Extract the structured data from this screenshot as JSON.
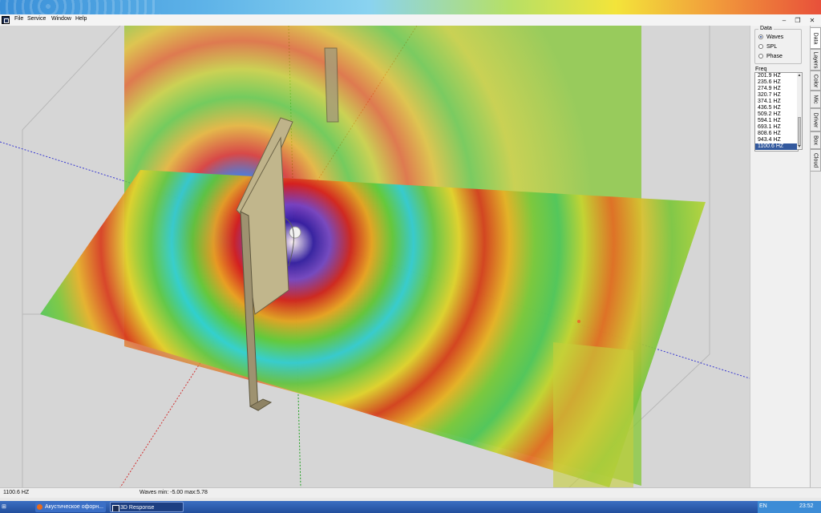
{
  "menu": [
    "File",
    "Service",
    "Window",
    "Help"
  ],
  "panel": {
    "data_group_label": "Data",
    "radios": [
      {
        "label": "Waves",
        "selected": true
      },
      {
        "label": "SPL",
        "selected": false
      },
      {
        "label": "Phase",
        "selected": false
      }
    ],
    "freq_label": "Freq",
    "frequencies": [
      "201.9 HZ",
      "235.6 HZ",
      "274.9 HZ",
      "320.7 HZ",
      "374.1 HZ",
      "436.5 HZ",
      "509.2 HZ",
      "594.1 HZ",
      "693.1 HZ",
      "808.6 HZ",
      "943.4 HZ",
      "1100.6 HZ"
    ],
    "selected_frequency": "1100.6 HZ"
  },
  "tabs": [
    "Data",
    "Layers",
    "Color",
    "Mic",
    "Driver",
    "Box",
    "Cloud"
  ],
  "status": {
    "frequency": "1100.6 HZ",
    "waves_range": "Waves min: -5.00 max:5.78"
  },
  "taskbar": [
    "Акустическое офорн...",
    "3D Response"
  ],
  "tray": {
    "language": "EN",
    "time": "23:52"
  }
}
